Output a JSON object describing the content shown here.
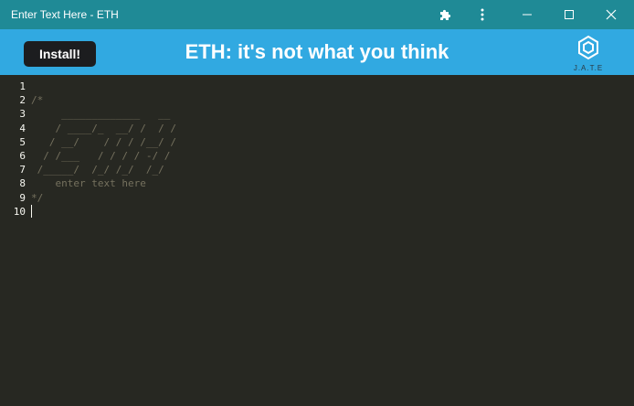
{
  "window": {
    "title": "Enter Text Here - ETH",
    "icons": [
      "puzzle-icon",
      "more-vertical-icon",
      "minimize-icon",
      "maximize-icon",
      "close-icon"
    ]
  },
  "header": {
    "install_label": "Install!",
    "heading": "ETH: it's not what you think",
    "logo_text": "J.A.T.E"
  },
  "editor": {
    "line_numbers": [
      "1",
      "2",
      "3",
      "4",
      "5",
      "6",
      "7",
      "8",
      "9",
      "10"
    ],
    "lines": [
      "",
      "/*",
      "     _____________   __",
      "    / ____/_  __/ /  / /",
      "   / __/    / / / /__/ /",
      "  / /___   / / / / -/ /",
      " /_____/  /_/ /_/  /_/",
      "    enter text here",
      "*/",
      ""
    ],
    "cursor_line": 10
  },
  "colors": {
    "titlebar": "#1f8a96",
    "header": "#31a9e1",
    "editor_bg": "#272822",
    "comment": "#75715e"
  }
}
